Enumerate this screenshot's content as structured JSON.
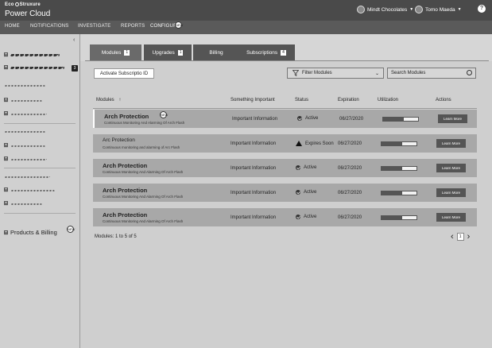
{
  "header": {
    "brand_left": "Eco",
    "brand_right": "Struxure",
    "app_title": "Power Cloud",
    "account": "Mindt Chocolates",
    "user": "Tomo Maeda",
    "help": "?"
  },
  "nav": {
    "items": [
      "HOME",
      "NOTIFICATIONS",
      "INVESTIGATE",
      "REPORTS",
      "CONFIGURE"
    ],
    "new_badge": "NEW"
  },
  "sidebar": {
    "collapse": "‹",
    "badge_count": "3",
    "products_label": "Products & Billing",
    "new_badge": "NEW"
  },
  "tabs": [
    {
      "label": "Modules",
      "count": "1"
    },
    {
      "label": "Upgrades",
      "count": "1"
    },
    {
      "label": "Billing",
      "count": ""
    },
    {
      "label": "Subscriptions",
      "count": "4"
    }
  ],
  "toolbar": {
    "activate_label": "Activate Subscriptio ID",
    "filter_label": "Filter Modules",
    "search_placeholder": "Search Modules"
  },
  "table": {
    "headers": [
      "Modules",
      "Something Important",
      "Status",
      "Expiration",
      "Utilization",
      "Actions"
    ],
    "sort_indicator": "↑",
    "rows": [
      {
        "name": "Arch Protection",
        "desc": "Continuous Monitoring And Alarming Of Arch Flash",
        "info": "Important Information",
        "status": "Active",
        "expiration": "06/27/2020",
        "utilization": 0.6,
        "action": "Learn More"
      },
      {
        "name": "Arc Protection",
        "desc": "Continuous monitoring and alarming of Arc Flash",
        "info": "Important Information",
        "status": "Expires Soon",
        "expiration": "06/27/2020",
        "utilization": 0.6,
        "action": "Learn More"
      },
      {
        "name": "Arch Protection",
        "desc": "Continuous Monitoring And Alarming Of Arch Flash",
        "info": "Important Information",
        "status": "Active",
        "expiration": "06/27/2020",
        "utilization": 0.6,
        "action": "Learn More"
      },
      {
        "name": "Arch Protection",
        "desc": "Continuous Monitoring And Alarming Of Arch Flash",
        "info": "Important Information",
        "status": "Active",
        "expiration": "06/27/2020",
        "utilization": 0.6,
        "action": "Learn More"
      },
      {
        "name": "Arch Protection",
        "desc": "Continuous Monitoring And Alarming Of Arch Flash",
        "info": "Important Information",
        "status": "Active",
        "expiration": "06/27/2020",
        "utilization": 0.6,
        "action": "Learn More"
      }
    ]
  },
  "footer": {
    "count": "Modules: 1 to 5 of 5",
    "page": "1",
    "prev": "‹",
    "next": "›"
  }
}
